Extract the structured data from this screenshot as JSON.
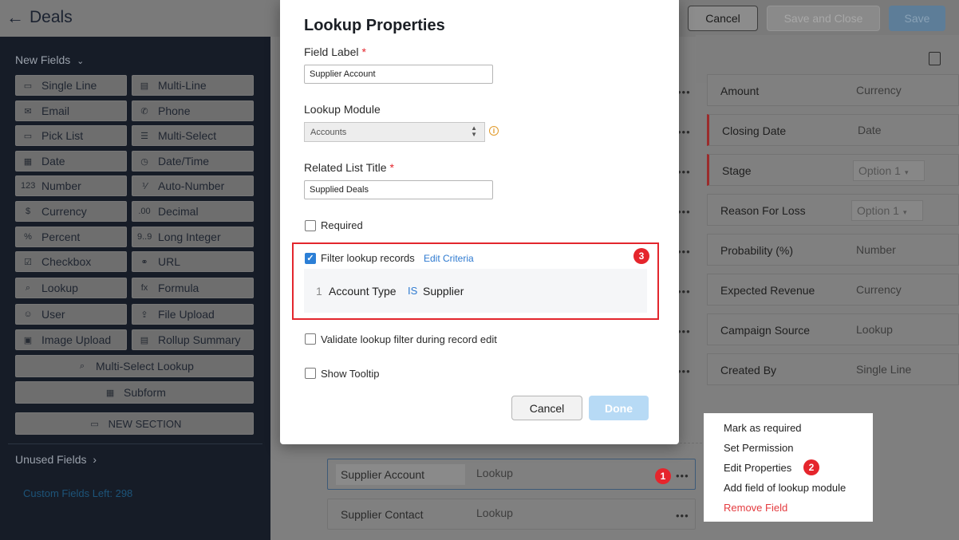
{
  "header": {
    "back_icon": "arrow-left-icon",
    "title": "Deals",
    "cancel_label": "Cancel",
    "save_close_label": "Save and Close",
    "save_label": "Save"
  },
  "sidebar": {
    "new_fields_label": "New Fields",
    "fields": [
      {
        "label": "Single Line",
        "icon": "single-line-icon",
        "glyph": "▭"
      },
      {
        "label": "Multi-Line",
        "icon": "multi-line-icon",
        "glyph": "▤"
      },
      {
        "label": "Email",
        "icon": "email-icon",
        "glyph": "✉"
      },
      {
        "label": "Phone",
        "icon": "phone-icon",
        "glyph": "✆"
      },
      {
        "label": "Pick List",
        "icon": "pick-list-icon",
        "glyph": "▭"
      },
      {
        "label": "Multi-Select",
        "icon": "multi-select-icon",
        "glyph": "☰"
      },
      {
        "label": "Date",
        "icon": "date-icon",
        "glyph": "▦"
      },
      {
        "label": "Date/Time",
        "icon": "date-time-icon",
        "glyph": "◷"
      },
      {
        "label": "Number",
        "icon": "number-icon",
        "glyph": "123"
      },
      {
        "label": "Auto-Number",
        "icon": "auto-number-icon",
        "glyph": "⅟"
      },
      {
        "label": "Currency",
        "icon": "currency-icon",
        "glyph": "$"
      },
      {
        "label": "Decimal",
        "icon": "decimal-icon",
        "glyph": ".00"
      },
      {
        "label": "Percent",
        "icon": "percent-icon",
        "glyph": "%"
      },
      {
        "label": "Long Integer",
        "icon": "long-integer-icon",
        "glyph": "9..9"
      },
      {
        "label": "Checkbox",
        "icon": "checkbox-icon",
        "glyph": "☑"
      },
      {
        "label": "URL",
        "icon": "url-icon",
        "glyph": "⚭"
      },
      {
        "label": "Lookup",
        "icon": "lookup-icon",
        "glyph": "⌕"
      },
      {
        "label": "Formula",
        "icon": "formula-icon",
        "glyph": "fx"
      },
      {
        "label": "User",
        "icon": "user-icon",
        "glyph": "☺"
      },
      {
        "label": "File Upload",
        "icon": "file-upload-icon",
        "glyph": "⇪"
      },
      {
        "label": "Image Upload",
        "icon": "image-upload-icon",
        "glyph": "▣"
      },
      {
        "label": "Rollup Summary",
        "icon": "rollup-summary-icon",
        "glyph": "▤"
      }
    ],
    "multi_select_lookup_label": "Multi-Select Lookup",
    "subform_label": "Subform",
    "new_section_label": "NEW SECTION",
    "unused_fields_label": "Unused Fields",
    "custom_fields_left": "Custom Fields Left: 298"
  },
  "canvas": {
    "rows": [
      {
        "label": "Amount",
        "type": "Currency",
        "required": false,
        "select": false
      },
      {
        "label": "Closing Date",
        "type": "Date",
        "required": true,
        "select": false
      },
      {
        "label": "Stage",
        "type": "Option 1",
        "required": true,
        "select": true
      },
      {
        "label": "Reason For Loss",
        "type": "Option 1",
        "required": false,
        "select": true
      },
      {
        "label": "Probability (%)",
        "type": "Number",
        "required": false,
        "select": false
      },
      {
        "label": "Expected Revenue",
        "type": "Currency",
        "required": false,
        "select": false
      },
      {
        "label": "Campaign Source",
        "type": "Lookup",
        "required": false,
        "select": false
      },
      {
        "label": "Created By",
        "type": "Single Line",
        "required": false,
        "select": false
      }
    ],
    "lookup_rows": [
      {
        "label": "Supplier Account",
        "type": "Lookup"
      },
      {
        "label": "Supplier Contact",
        "type": "Lookup"
      }
    ],
    "more_glyph": "•••"
  },
  "context_menu": {
    "items": [
      "Mark as required",
      "Set Permission",
      "Edit Properties",
      "Add field of lookup module",
      "Remove Field"
    ]
  },
  "badges": [
    "1",
    "2",
    "3"
  ],
  "modal": {
    "title": "Lookup Properties",
    "field_label_label": "Field Label",
    "field_label_value": "Supplier Account",
    "lookup_module_label": "Lookup Module",
    "lookup_module_value": "Accounts",
    "related_list_title_label": "Related List Title",
    "related_list_title_value": "Supplied Deals",
    "required_label": "Required",
    "filter_label": "Filter lookup records",
    "edit_criteria_label": "Edit Criteria",
    "criteria": {
      "num": "1",
      "field": "Account Type",
      "operator": "IS",
      "value": "Supplier"
    },
    "validate_label": "Validate lookup filter during record edit",
    "tooltip_label": "Show Tooltip",
    "cancel_label": "Cancel",
    "done_label": "Done",
    "required_mark": "*"
  },
  "colors": {
    "sidebar_bg": "#161c27",
    "accent": "#2c7fd6",
    "badge": "#e5252c",
    "danger": "#e43b3f"
  }
}
